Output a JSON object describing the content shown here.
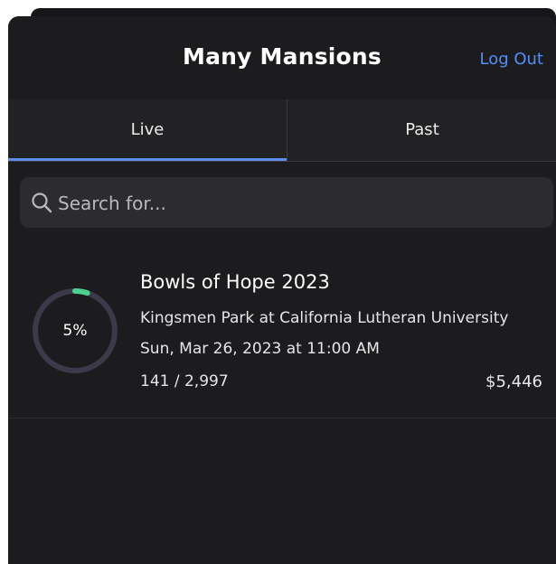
{
  "header": {
    "title": "Many Mansions",
    "logout_label": "Log Out"
  },
  "tabs": [
    {
      "label": "Live",
      "active": true
    },
    {
      "label": "Past",
      "active": false
    }
  ],
  "search": {
    "placeholder": "Search for...",
    "value": ""
  },
  "events": [
    {
      "name": "Bowls of Hope 2023",
      "venue": "Kingsmen Park at California Lutheran University",
      "date": "Sun, Mar 26, 2023 at 11:00 AM",
      "count": "141 / 2,997",
      "amount": "$5,446",
      "progress_label": "5%",
      "progress_fraction": 0.05
    }
  ],
  "colors": {
    "background": "#1c1c1e",
    "accent": "#4f8ff7",
    "tab_indicator": "#5b8ee8",
    "progress": "#4cd08d",
    "progress_track": "#3a3a4a"
  },
  "icons": {
    "search": "magnifier-icon",
    "progress": "progress-ring"
  }
}
